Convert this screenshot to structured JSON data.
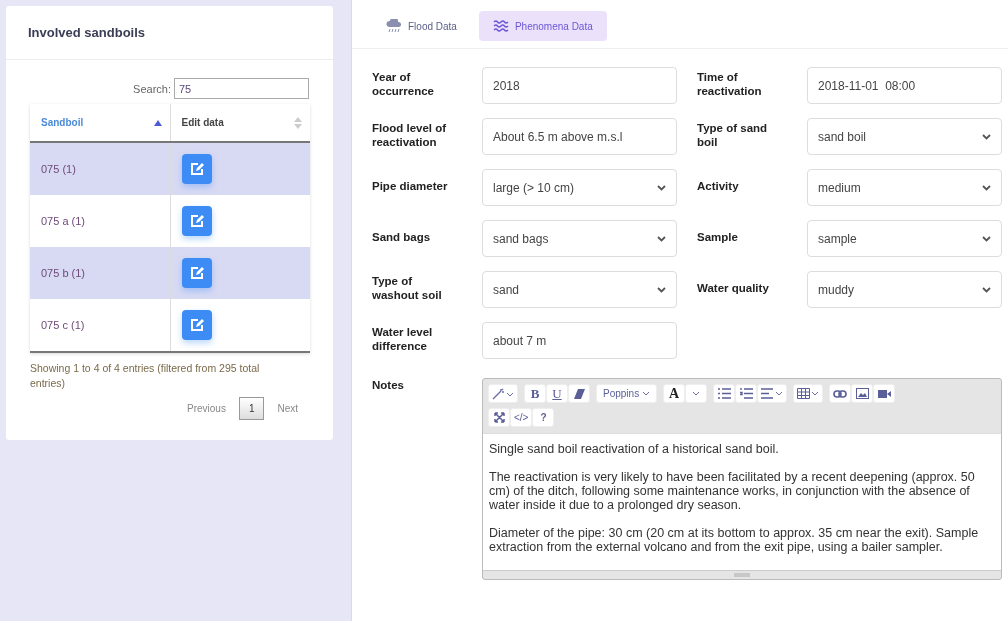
{
  "sidebar": {
    "title": "Involved sandboils",
    "search": {
      "label": "Search:",
      "value": "75"
    },
    "table": {
      "columns": [
        {
          "label": "Sandboil",
          "sorted": true
        },
        {
          "label": "Edit data",
          "sorted": false
        }
      ],
      "rows": [
        {
          "name": "075 (1)",
          "highlighted": true
        },
        {
          "name": "075 a (1)",
          "highlighted": false
        },
        {
          "name": "075 b (1)",
          "highlighted": true
        },
        {
          "name": "075 c (1)",
          "highlighted": false
        }
      ]
    },
    "info": "Showing 1 to 4 of 4 entries (filtered from 295 total entries)",
    "pagination": [
      {
        "label": "Previous",
        "kind": "link",
        "selected": false
      },
      {
        "label": "1",
        "kind": "page",
        "selected": true
      },
      {
        "label": "Next",
        "kind": "link",
        "selected": false
      }
    ]
  },
  "tabs": [
    {
      "label": "Flood Data",
      "selected": false,
      "kind": "rain"
    },
    {
      "label": "Phenomena Data",
      "selected": true,
      "kind": "waves"
    }
  ],
  "fields": [
    {
      "label": "Year of occurrence",
      "kind": "input",
      "value": "2018"
    },
    {
      "label": "Time of reactivation",
      "kind": "input",
      "value": "2018-11-01  08:00"
    },
    {
      "label": "Flood level of reactivation",
      "kind": "input",
      "value": "About 6.5 m above m.s.l"
    },
    {
      "label": "Type of sand boil",
      "kind": "select",
      "value": "sand boil"
    },
    {
      "label": "Pipe diameter",
      "kind": "select",
      "value": "large (> 10 cm)"
    },
    {
      "label": "Activity",
      "kind": "select",
      "value": "medium"
    },
    {
      "label": "Sand bags",
      "kind": "select",
      "value": "sand bags"
    },
    {
      "label": "Sample",
      "kind": "select",
      "value": "sample"
    },
    {
      "label": "Type of washout soil",
      "kind": "select",
      "value": "sand"
    },
    {
      "label": "Water quality",
      "kind": "select",
      "value": "muddy"
    },
    {
      "label": "Water level difference",
      "kind": "input",
      "value": "about 7 m"
    }
  ],
  "notes": {
    "label": "Notes",
    "toolbar": {
      "bold": "B",
      "underline": "U",
      "font": "Poppins",
      "font_color": "A",
      "code": "</>",
      "help": "?"
    },
    "paragraphs": [
      "Single sand boil reactivation of a historical sand boil.",
      "The reactivation is very likely to have been facilitated by a recent deepening (approx. 50 cm) of the ditch, following some maintenance works, in conjunction with the absence of water inside it due to a prolonged dry season.",
      "Diameter of the pipe: 30 cm (20 cm at its bottom to approx. 35 cm near the exit). Sample extraction from the external volcano and from the exit pipe, using a bailer sampler."
    ]
  }
}
